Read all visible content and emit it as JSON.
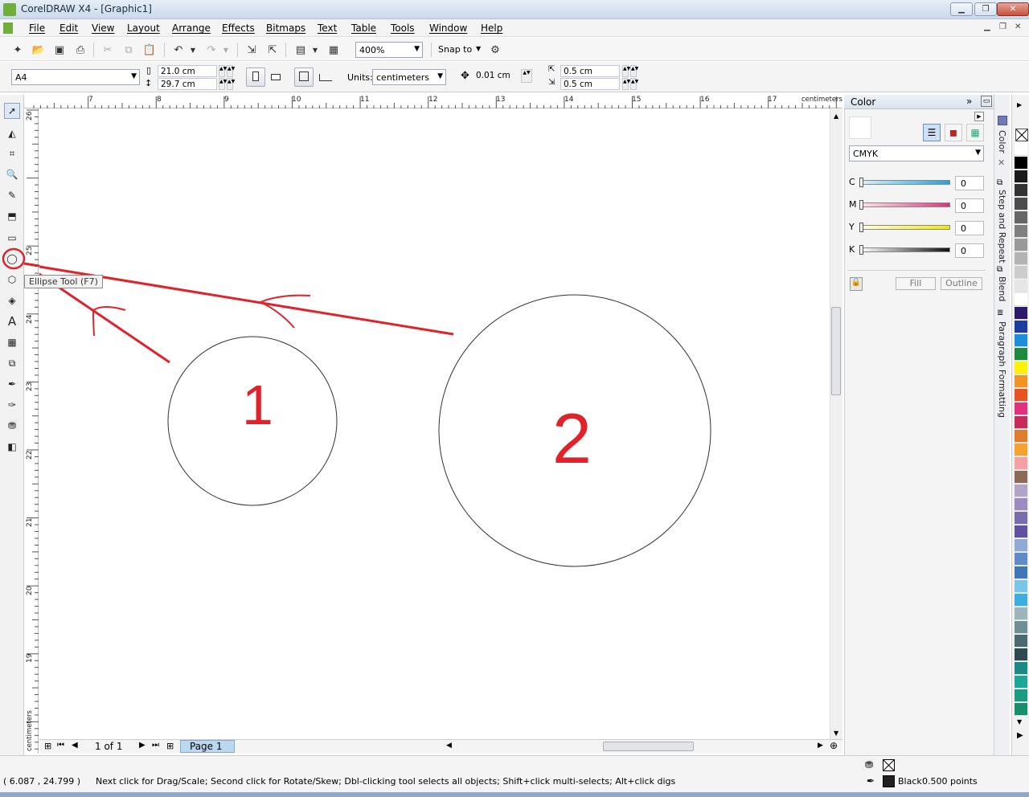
{
  "window": {
    "title": "CorelDRAW X4 - [Graphic1]"
  },
  "menu": [
    "File",
    "Edit",
    "View",
    "Layout",
    "Arrange",
    "Effects",
    "Bitmaps",
    "Text",
    "Table",
    "Tools",
    "Window",
    "Help"
  ],
  "standard_toolbar": {
    "zoom": "400%",
    "snap_to": "Snap to"
  },
  "property_bar": {
    "page_size": "A4",
    "width": "21.0 cm",
    "height": "29.7 cm",
    "units_label": "Units:",
    "units": "centimeters",
    "nudge": "0.01 cm",
    "dup_x": "0.5 cm",
    "dup_y": "0.5 cm"
  },
  "rulers": {
    "unit": "centimeters",
    "h_ticks": [
      "7",
      "8",
      "9",
      "10",
      "11",
      "12",
      "13",
      "14",
      "15",
      "16",
      "17"
    ],
    "v_ticks": [
      "25",
      "24",
      "23",
      "22",
      "21",
      "20",
      "19",
      "26"
    ]
  },
  "tooltip": "Ellipse Tool (F7)",
  "canvas": {
    "label_1": "1",
    "label_2": "2"
  },
  "pager": {
    "position": "1 of 1",
    "page_tab": "Page 1"
  },
  "docker": {
    "title": "Color",
    "model": "CMYK",
    "channels": [
      {
        "name": "C",
        "value": "0",
        "color_start": "#d8f0ff",
        "color_end": "#1fa3e0"
      },
      {
        "name": "M",
        "value": "0",
        "color_start": "#ffe3ee",
        "color_end": "#e3327a"
      },
      {
        "name": "Y",
        "value": "0",
        "color_start": "#ffffe0",
        "color_end": "#f2e60a"
      },
      {
        "name": "K",
        "value": "0",
        "color_start": "#ffffff",
        "color_end": "#111111"
      }
    ],
    "fill_button": "Fill",
    "outline_button": "Outline"
  },
  "side_tabs": [
    "Color",
    "Step and Repeat",
    "Blend",
    "Paragraph Formatting"
  ],
  "palette": [
    "#ffffff",
    "#000000",
    "#1a1a1a",
    "#333333",
    "#4d4d4d",
    "#666666",
    "#7f7f7f",
    "#999999",
    "#b3b3b3",
    "#cccccc",
    "#e6e6e6",
    "#ffffff",
    "#2e1a6b",
    "#1a3f9e",
    "#1d8fd8",
    "#1a8c3a",
    "#fff200",
    "#f39322",
    "#e8531f",
    "#e5317d",
    "#c92a5a",
    "#e07d2a",
    "#f5a32d",
    "#f7a0a3",
    "#8c6a57",
    "#b2a3c9",
    "#9c8ac0",
    "#7b6bb0",
    "#6251a0",
    "#8dabd6",
    "#5f8cc9",
    "#3f76b8",
    "#79c6e8",
    "#3bb0df",
    "#9bb6b8",
    "#6f8f96",
    "#4a6a72",
    "#2f4b52",
    "#1b8a85",
    "#1ba69a",
    "#1a9b82",
    "#178f6b"
  ],
  "status": {
    "coords": "( 6.087 , 24.799 )",
    "hint": "Next click for Drag/Scale; Second click for Rotate/Skew; Dbl-clicking tool selects all objects; Shift+click multi-selects; Alt+click digs",
    "outline_color": "Black",
    "outline_width": "0.500 points"
  }
}
